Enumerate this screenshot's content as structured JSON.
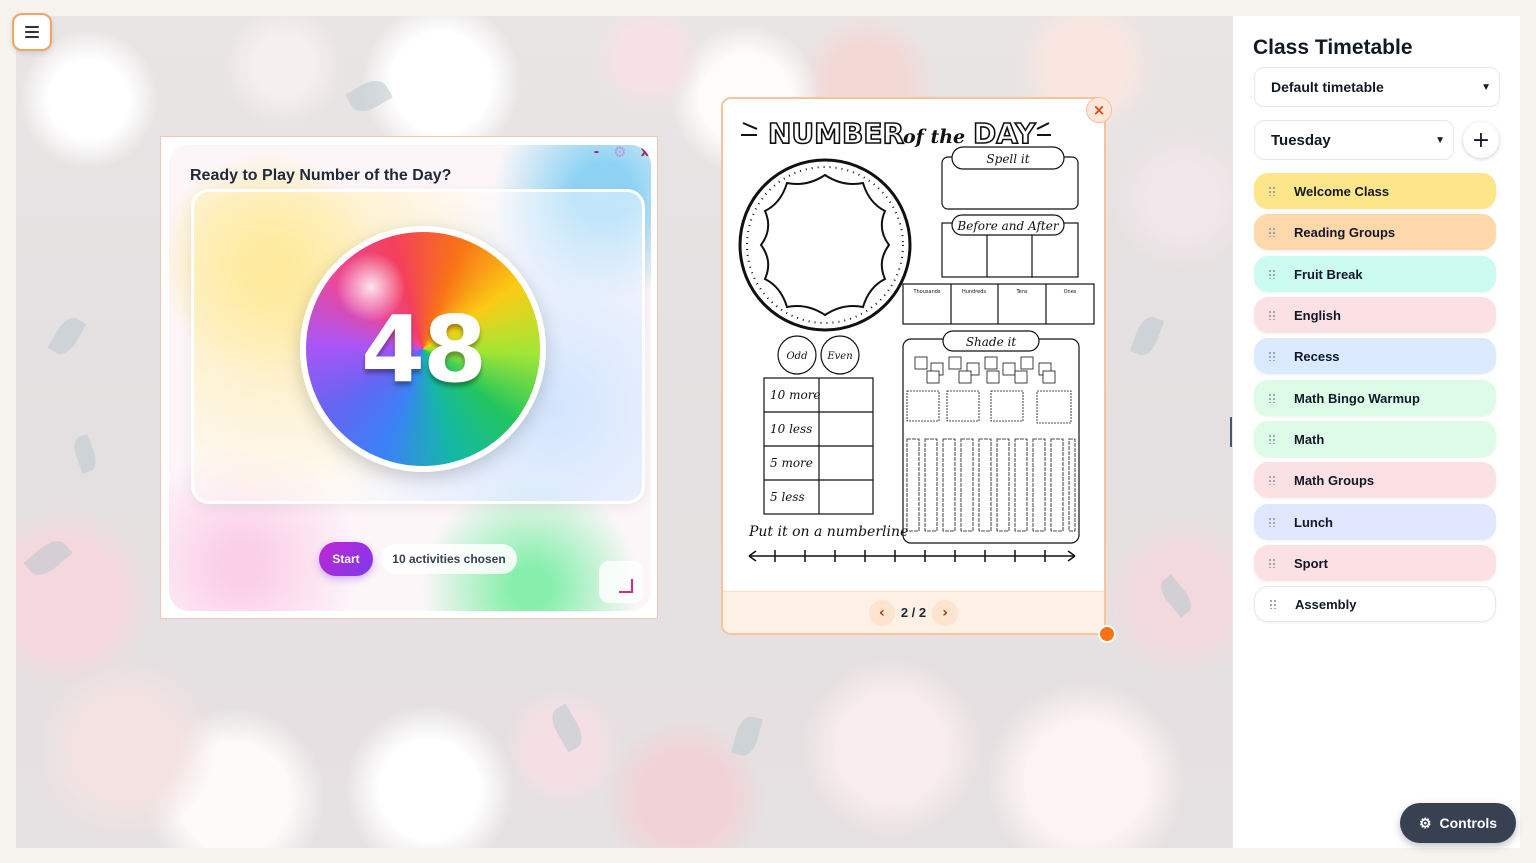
{
  "game": {
    "title": "Ready to Play Number of the Day?",
    "number": "48",
    "start_label": "Start",
    "chosen_label": "10 activities chosen",
    "minimize_icon": "minimize-icon",
    "settings_icon": "gear-icon",
    "close_icon": "close-icon"
  },
  "worksheet": {
    "heading_number": "NUMBER",
    "heading_of": "of the",
    "heading_day": "DAY",
    "spell_it": "Spell it",
    "before_after": "Before and After",
    "place_values": [
      "Thousands",
      "Hundreds",
      "Tens",
      "Ones"
    ],
    "odd": "Odd",
    "even": "Even",
    "shade_it": "Shade it",
    "more_less": [
      "10 more",
      "10 less",
      "5 more",
      "5 less"
    ],
    "numberline": "Put it on a numberline",
    "page_indicator": "2 / 2",
    "prev_icon": "chevron-left-icon",
    "next_icon": "chevron-right-icon"
  },
  "timetable": {
    "title": "Class Timetable",
    "timetable_select": "Default timetable",
    "day_select": "Tuesday",
    "add_label": "+",
    "slots": [
      {
        "label": "Welcome Class",
        "color": "#fde68a"
      },
      {
        "label": "Reading Groups",
        "color": "#fed7aa"
      },
      {
        "label": "Fruit Break",
        "color": "#ccfbf1"
      },
      {
        "label": "English",
        "color": "#fce1e4"
      },
      {
        "label": "Recess",
        "color": "#dbeafe"
      },
      {
        "label": "Math Bingo Warmup",
        "color": "#dcfce7"
      },
      {
        "label": "Math",
        "color": "#dcfce7"
      },
      {
        "label": "Math Groups",
        "color": "#fce1e4"
      },
      {
        "label": "Lunch",
        "color": "#e0e7ff"
      },
      {
        "label": "Sport",
        "color": "#fce1e4"
      },
      {
        "label": "Assembly",
        "color": "#ffffff"
      }
    ]
  },
  "controls": {
    "label": "Controls",
    "icon": "gear-icon"
  }
}
